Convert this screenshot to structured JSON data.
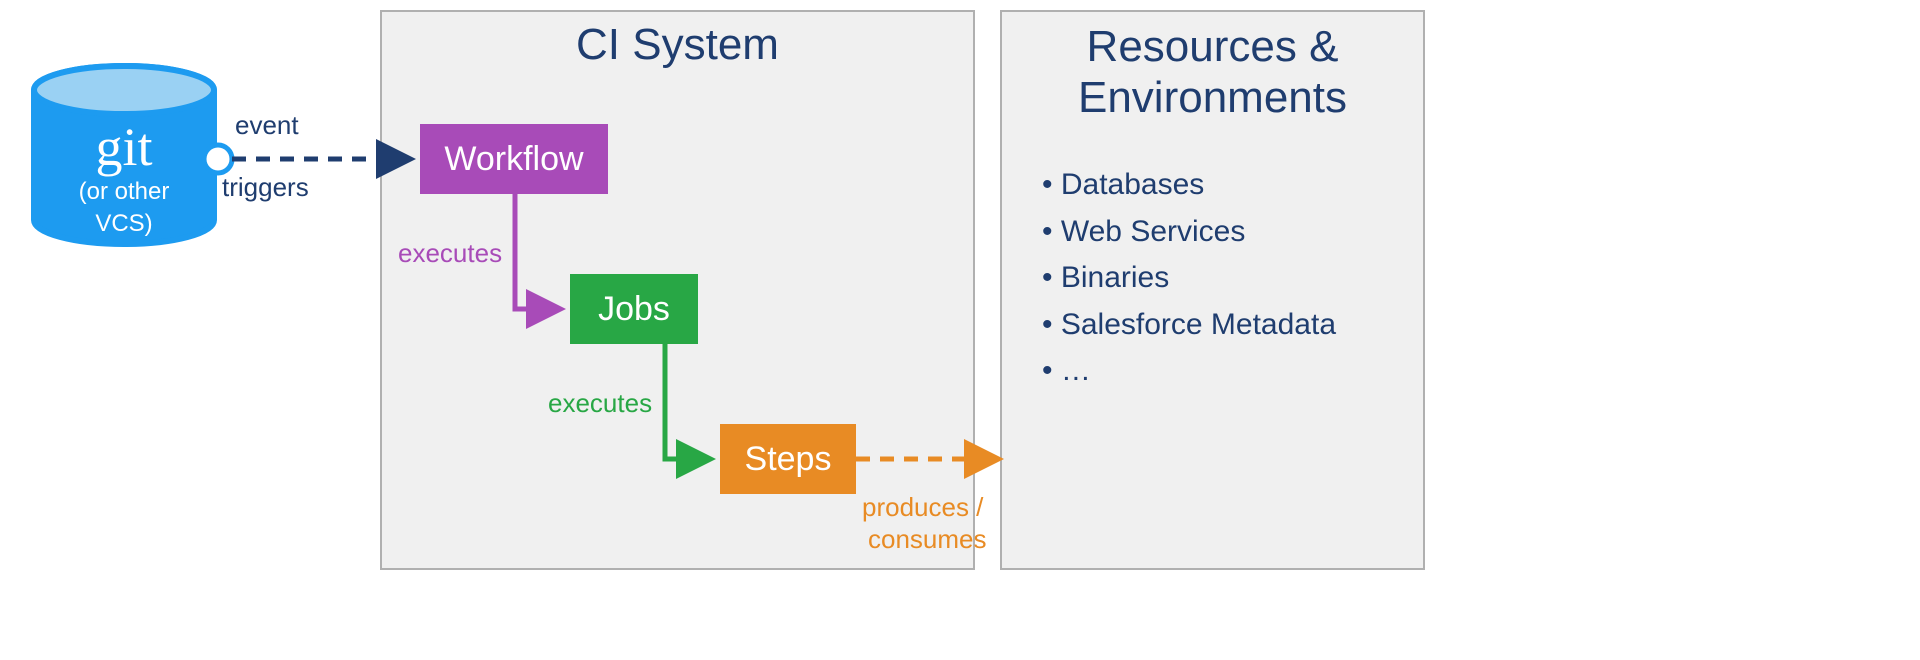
{
  "git": {
    "title": "git",
    "subtitle1": "(or other",
    "subtitle2": "VCS)"
  },
  "edges": {
    "event": "event",
    "triggers": "triggers",
    "executes1": "executes",
    "executes2": "executes",
    "produces": "produces /",
    "consumes": "consumes"
  },
  "ci": {
    "title": "CI System",
    "workflow": "Workflow",
    "jobs": "Jobs",
    "steps": "Steps"
  },
  "resources": {
    "title1": "Resources &",
    "title2": "Environments",
    "items": {
      "0": "Databases",
      "1": "Web Services",
      "2": "Binaries",
      "3": "Salesforce Metadata",
      "4": "…"
    }
  },
  "colors": {
    "navy": "#1f3d6f",
    "purple": "#a84bb8",
    "green": "#28a745",
    "orange": "#e88b24",
    "blue": "#1d9bf0",
    "lightblue": "#9ad1f3"
  }
}
